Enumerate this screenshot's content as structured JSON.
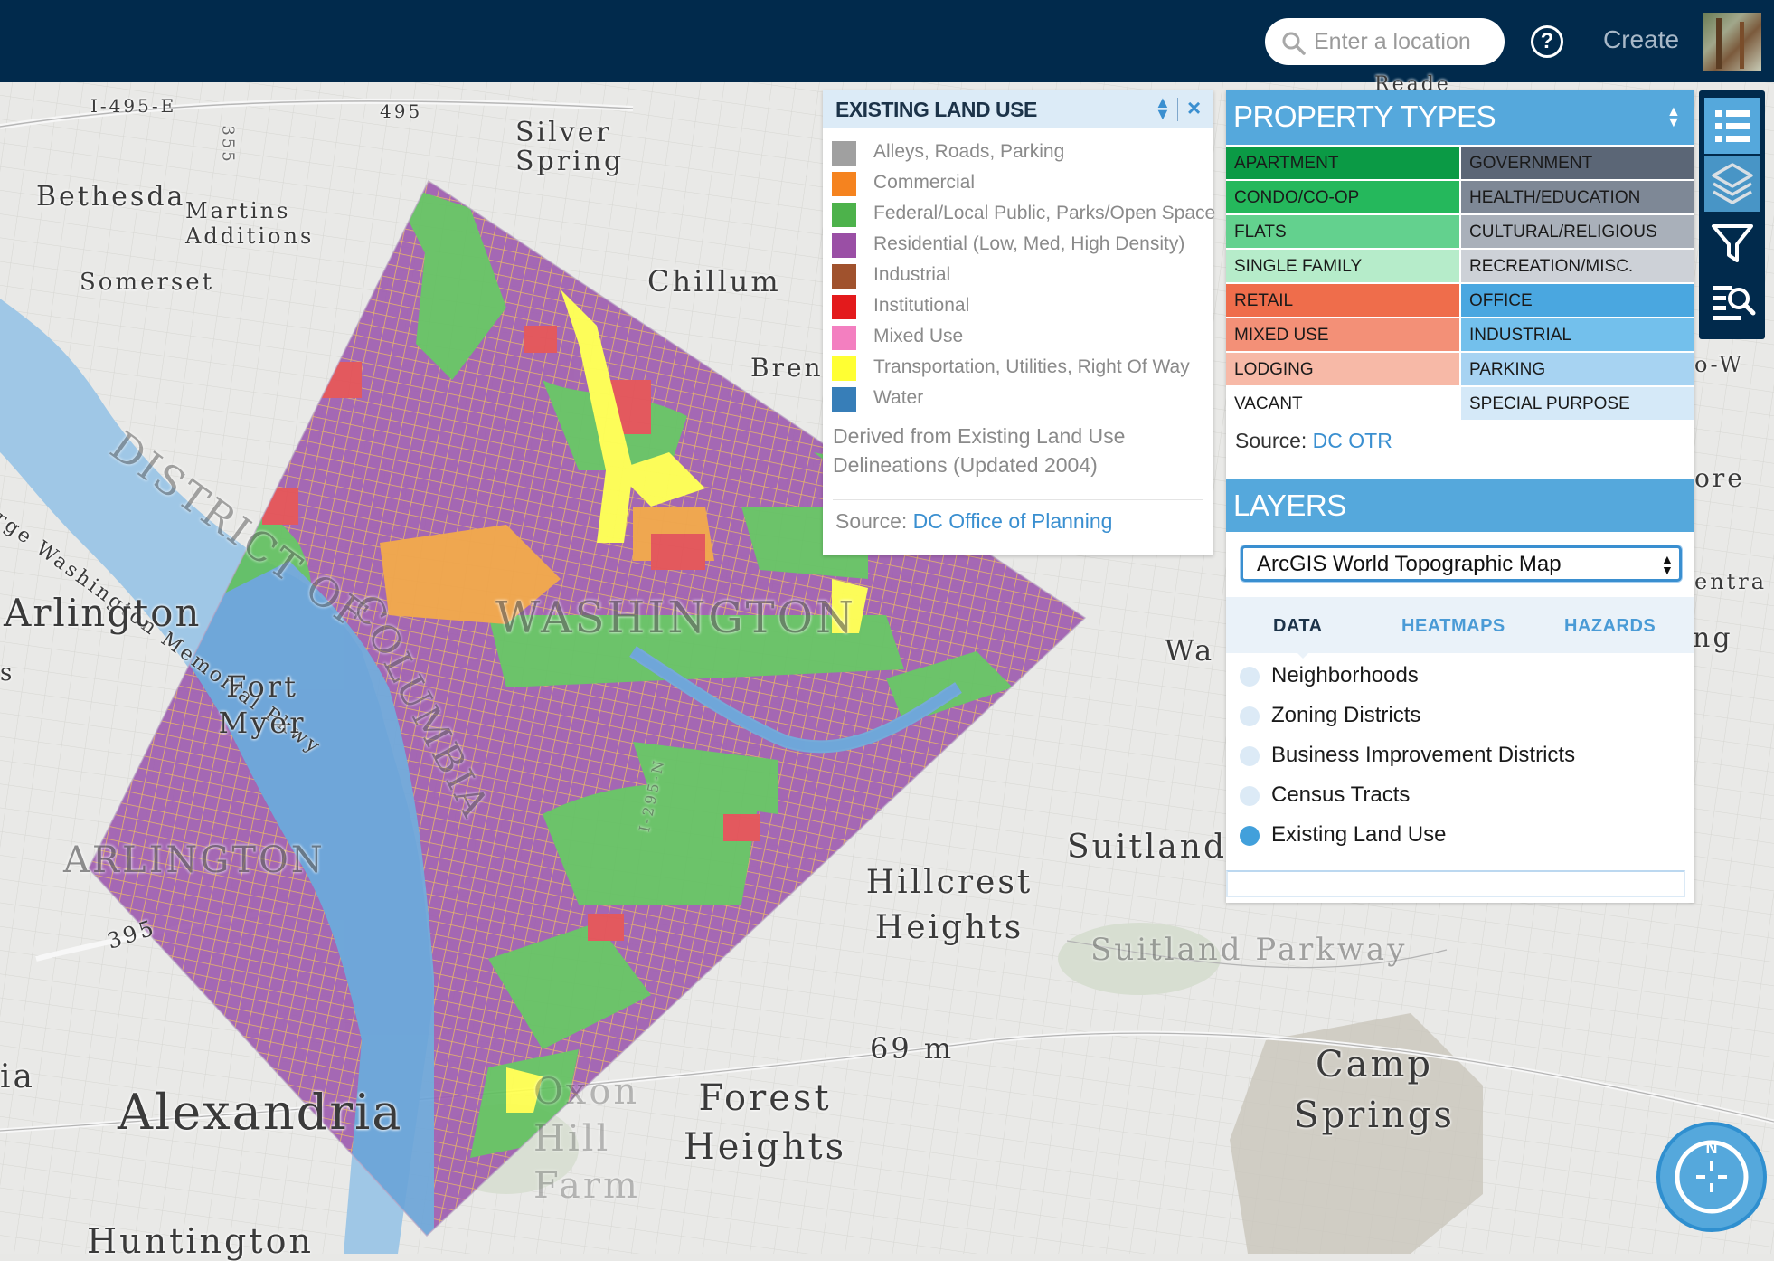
{
  "header": {
    "search_placeholder": "Enter a location",
    "help_label": "?",
    "create_label": "Create",
    "icons": {
      "search": "search-icon",
      "help": "help-circle-icon",
      "avatar": "user-avatar"
    }
  },
  "colors": {
    "header_bg": "#012a4c",
    "accent": "#55a8dc",
    "link": "#3a8fd0"
  },
  "map": {
    "labels": {
      "i495": "I-495-E",
      "r495": "495",
      "r355": "355",
      "silver_spring": "Silver Spring",
      "bethesda": "Bethesda",
      "martins_additions": "Martins Additions",
      "somerset": "Somerset",
      "chillum": "Chillum",
      "brentwood": "Bren",
      "george_washington": "George Washington Memorial Pkwy",
      "district_of": "DISTRICT OF",
      "columbia": "COLUMBIA",
      "washington": "WASHINGTON",
      "arlington": "Arlington",
      "fort_myer": "Fort Myer",
      "arlington_county": "ARLINGTON",
      "r395": "395",
      "hillcrest_heights": "Hillcrest Heights",
      "suitland": "Suitland",
      "suitland_parkway": "Suitland Parkway",
      "mi69": "69 m",
      "camp_springs": "Camp Springs",
      "alexandria": "Alexandria",
      "forest_heights": "Forest Heights",
      "oxon_hill": "Oxon Hill Farm",
      "huntington": "Huntington",
      "i295": "I-295-N",
      "edge_ia": "ia",
      "edge_wa": "Wa",
      "edge_ng": "ng",
      "edge_ore": "ore",
      "edge_entra": "entra",
      "edge_dw": "o-W",
      "edge_reade": "Reade",
      "edge_s": "s"
    }
  },
  "land_use": {
    "title": "EXISTING LAND USE",
    "items": [
      {
        "label": "Alleys, Roads, Parking",
        "color": "#a0a0a0"
      },
      {
        "label": "Commercial",
        "color": "#f5831f"
      },
      {
        "label": "Federal/Local Public, Parks/Open Space",
        "color": "#4db24b"
      },
      {
        "label": "Residential (Low, Med, High Density)",
        "color": "#9a4fa5"
      },
      {
        "label": "Industrial",
        "color": "#a0522d"
      },
      {
        "label": "Institutional",
        "color": "#e31a1c"
      },
      {
        "label": "Mixed Use",
        "color": "#f37fc0"
      },
      {
        "label": "Transportation, Utilities, Right Of Way",
        "color": "#ffff33"
      },
      {
        "label": "Water",
        "color": "#377eb8"
      }
    ],
    "derived_note": "Derived from Existing Land Use Delineations (Updated 2004)",
    "source_label": "Source:",
    "source_link": "DC Office of Planning"
  },
  "property_types": {
    "title": "PROPERTY TYPES",
    "cells": [
      {
        "label": "APARTMENT",
        "color": "#0b9a45"
      },
      {
        "label": "GOVERNMENT",
        "color": "#5b6676"
      },
      {
        "label": "CONDO/CO-OP",
        "color": "#25b85c"
      },
      {
        "label": "HEALTH/EDUCATION",
        "color": "#7e8896"
      },
      {
        "label": "FLATS",
        "color": "#63d18e"
      },
      {
        "label": "CULTURAL/RELIGIOUS",
        "color": "#a9b0ba"
      },
      {
        "label": "SINGLE FAMILY",
        "color": "#b6ecca"
      },
      {
        "label": "RECREATION/MISC.",
        "color": "#cdd1d7"
      },
      {
        "label": "RETAIL",
        "color": "#ef6d4b"
      },
      {
        "label": "OFFICE",
        "color": "#4aa7e0"
      },
      {
        "label": "MIXED USE",
        "color": "#f39077"
      },
      {
        "label": "INDUSTRIAL",
        "color": "#73c0ec"
      },
      {
        "label": "LODGING",
        "color": "#f7b9a7"
      },
      {
        "label": "PARKING",
        "color": "#a7d3f2"
      },
      {
        "label": "VACANT",
        "color": "#ffffff"
      },
      {
        "label": "SPECIAL PURPOSE",
        "color": "#d5e9f8"
      }
    ],
    "source_label": "Source:",
    "source_link": "DC OTR"
  },
  "layers": {
    "title": "LAYERS",
    "basemap_value": "ArcGIS World Topographic Map",
    "tabs": [
      {
        "label": "DATA",
        "active": true
      },
      {
        "label": "HEATMAPS",
        "active": false
      },
      {
        "label": "HAZARDS",
        "active": false
      }
    ],
    "items": [
      {
        "label": "Neighborhoods",
        "on": false
      },
      {
        "label": "Zoning Districts",
        "on": false
      },
      {
        "label": "Business Improvement Districts",
        "on": false
      },
      {
        "label": "Census Tracts",
        "on": false
      },
      {
        "label": "Existing Land Use",
        "on": true
      }
    ]
  },
  "tools": [
    {
      "icon": "list-icon",
      "active": true
    },
    {
      "icon": "layers-icon",
      "active": true
    },
    {
      "icon": "filter-icon",
      "active": false
    },
    {
      "icon": "search-list-icon",
      "active": false
    }
  ],
  "compass": {
    "label": "N",
    "icon": "compass-icon"
  }
}
